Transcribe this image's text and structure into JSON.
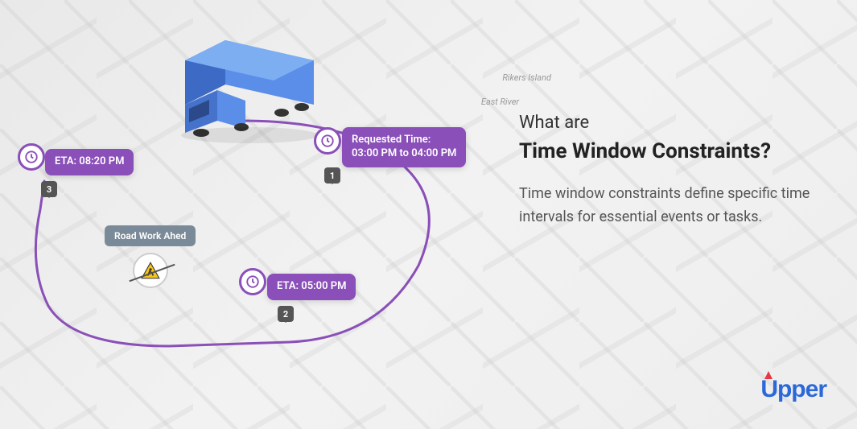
{
  "map": {
    "labels": [
      "Rikers Island",
      "East River"
    ]
  },
  "text": {
    "heading_small": "What are",
    "heading_large": "Time Window Constraints?",
    "description": "Time window constraints define specific time intervals for essential events or tasks."
  },
  "stops": {
    "stop1": {
      "num": "1",
      "title": "Requested Time:",
      "time": "03:00 PM to 04:00 PM"
    },
    "stop2": {
      "num": "2",
      "eta": "ETA: 05:00 PM"
    },
    "stop3": {
      "num": "3",
      "eta": "ETA: 08:20 PM"
    }
  },
  "roadwork": {
    "label": "Road Work Ahed"
  },
  "logo": {
    "text": "pper"
  },
  "colors": {
    "purple": "#8a4fb8",
    "blue": "#2b68d8",
    "grey": "#7a8a99"
  }
}
